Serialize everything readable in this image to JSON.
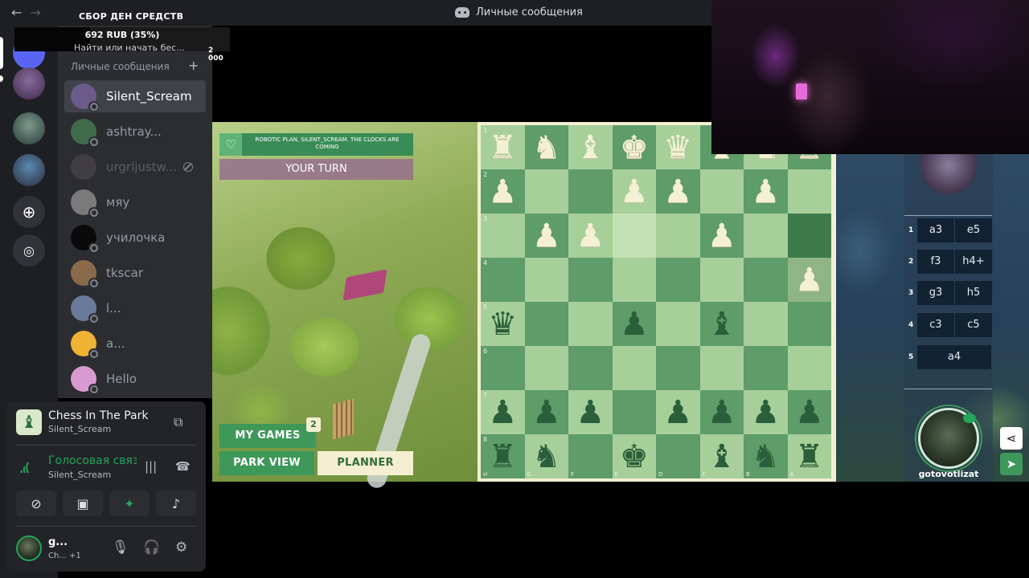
{
  "window": {
    "title": "Личные сообщения",
    "back": "←",
    "forward": "→"
  },
  "donation": {
    "title": "СБОР ДЕН СРЕДСТВ",
    "amount": "692 RUB (35%)",
    "progress": 0.35,
    "goal": "2 000",
    "subtitle": "Найти или начать бес..."
  },
  "sidebar": {
    "header": "Личные сообщения",
    "add": "+",
    "dms": [
      {
        "name": "Silent_Scream",
        "color": "#6b5a8a"
      },
      {
        "name": "ashtray...",
        "color": "#3f6b4a"
      },
      {
        "name": "urgrljustw...",
        "color": "#555055"
      },
      {
        "name": "мяу",
        "color": "#7a7a7a"
      },
      {
        "name": "училочка",
        "color": "#0a0a0a"
      },
      {
        "name": "tkscar",
        "color": "#8a6a4a"
      },
      {
        "name": "l...",
        "color": "#6a7a9a"
      },
      {
        "name": "a...",
        "color": "#f0b232"
      },
      {
        "name": "Hello",
        "color": "#d89ad0"
      }
    ]
  },
  "activity": {
    "title": "Chess In The Park",
    "subtitle": "Silent_Scream"
  },
  "voice": {
    "title": "Голосовая связь",
    "subtitle": "Silent_Scream"
  },
  "user": {
    "name": "g...",
    "status": "Ch...",
    "extra": "+1"
  },
  "game": {
    "banner": "ROBOTIC PLAN, SILENT_SCREAM. THE CLOCKS ARE COMING",
    "your_turn": "YOUR TURN",
    "my_games": "MY GAMES",
    "my_games_count": "2",
    "park_view": "PARK VIEW",
    "planner": "PLANNER"
  },
  "board": {
    "ranks": [
      "1",
      "2",
      "3",
      "4",
      "5",
      "6",
      "7",
      "8"
    ],
    "files": [
      "H",
      "G",
      "F",
      "E",
      "D",
      "C",
      "B",
      "A"
    ],
    "rows": [
      [
        "wR",
        "wN",
        "wB",
        "wK",
        "wQ",
        "wB",
        "wN",
        "wR"
      ],
      [
        "wP",
        "",
        "",
        "wP",
        "wP",
        "",
        "wP",
        ""
      ],
      [
        "",
        "wP",
        "wP",
        "",
        "",
        "wP",
        "",
        ""
      ],
      [
        "",
        "",
        "",
        "",
        "",
        "",
        "",
        "wP"
      ],
      [
        "bQ",
        "",
        "",
        "bP",
        "",
        "bB",
        "",
        ""
      ],
      [
        "",
        "",
        "",
        "",
        "",
        "",
        "",
        ""
      ],
      [
        "bP",
        "bP",
        "bP",
        "",
        "bP",
        "bP",
        "bP",
        "bP"
      ],
      [
        "bR",
        "bN",
        "",
        "bK",
        "",
        "bB",
        "bN",
        "bR"
      ]
    ]
  },
  "moves": [
    {
      "num": "1",
      "white": "a3",
      "black": "e5"
    },
    {
      "num": "2",
      "white": "f3",
      "black": "h4+"
    },
    {
      "num": "3",
      "white": "g3",
      "black": "h5"
    },
    {
      "num": "4",
      "white": "c3",
      "black": "c5"
    },
    {
      "num": "5",
      "white": "a4",
      "black": ""
    }
  ],
  "player": {
    "name": "gotovotlizat"
  },
  "colors": {
    "accent_green": "#3e9859",
    "cream": "#f4efd2",
    "discord_bg": "#2b2d31"
  }
}
